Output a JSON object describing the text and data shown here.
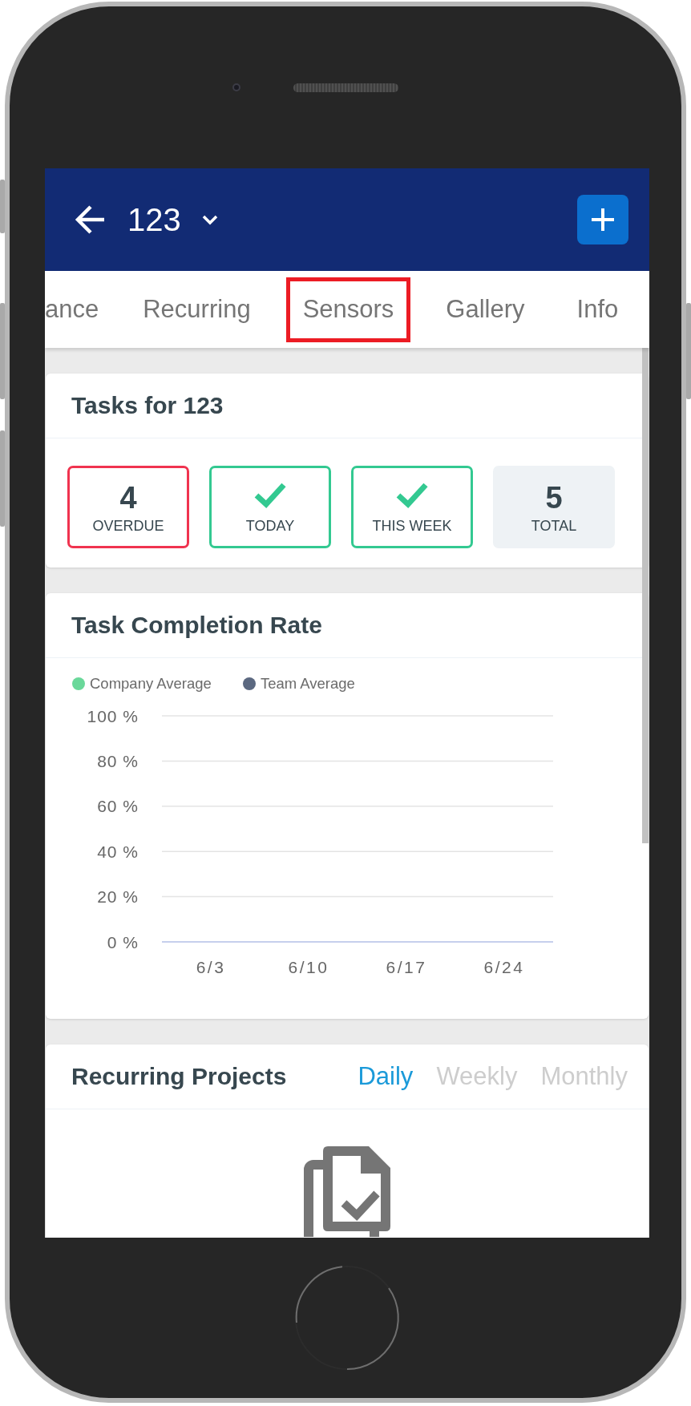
{
  "header": {
    "title": "123"
  },
  "tabs": [
    {
      "label": "ance",
      "highlighted": false
    },
    {
      "label": "Recurring",
      "highlighted": false
    },
    {
      "label": "Sensors",
      "highlighted": true
    },
    {
      "label": "Gallery",
      "highlighted": false
    },
    {
      "label": "Info",
      "highlighted": false
    }
  ],
  "tasks_card": {
    "title": "Tasks for 123",
    "stats": [
      {
        "kind": "overdue",
        "value": "4",
        "label": "OVERDUE"
      },
      {
        "kind": "done",
        "label": "TODAY"
      },
      {
        "kind": "done",
        "label": "THIS WEEK"
      },
      {
        "kind": "total",
        "value": "5",
        "label": "TOTAL"
      }
    ]
  },
  "completion_card": {
    "title": "Task Completion Rate",
    "chart_data": {
      "type": "line",
      "grid": true,
      "categories": [
        "6/3",
        "6/10",
        "6/17",
        "6/24"
      ],
      "series": [
        {
          "name": "Company Average",
          "color": "#6ad89a",
          "values": [
            null,
            null,
            null,
            null
          ]
        },
        {
          "name": "Team Average",
          "color": "#5b6880",
          "values": [
            null,
            null,
            null,
            null
          ]
        }
      ],
      "ylim": [
        0,
        100
      ],
      "yticks": [
        {
          "value": 0,
          "label": "0 %"
        },
        {
          "value": 20,
          "label": "20 %"
        },
        {
          "value": 40,
          "label": "40 %"
        },
        {
          "value": 60,
          "label": "60 %"
        },
        {
          "value": 80,
          "label": "80 %"
        },
        {
          "value": 100,
          "label": "100 %"
        }
      ]
    }
  },
  "recurring_card": {
    "title": "Recurring Projects",
    "periods": [
      {
        "label": "Daily",
        "selected": true
      },
      {
        "label": "Weekly",
        "selected": false
      },
      {
        "label": "Monthly",
        "selected": false
      }
    ]
  }
}
